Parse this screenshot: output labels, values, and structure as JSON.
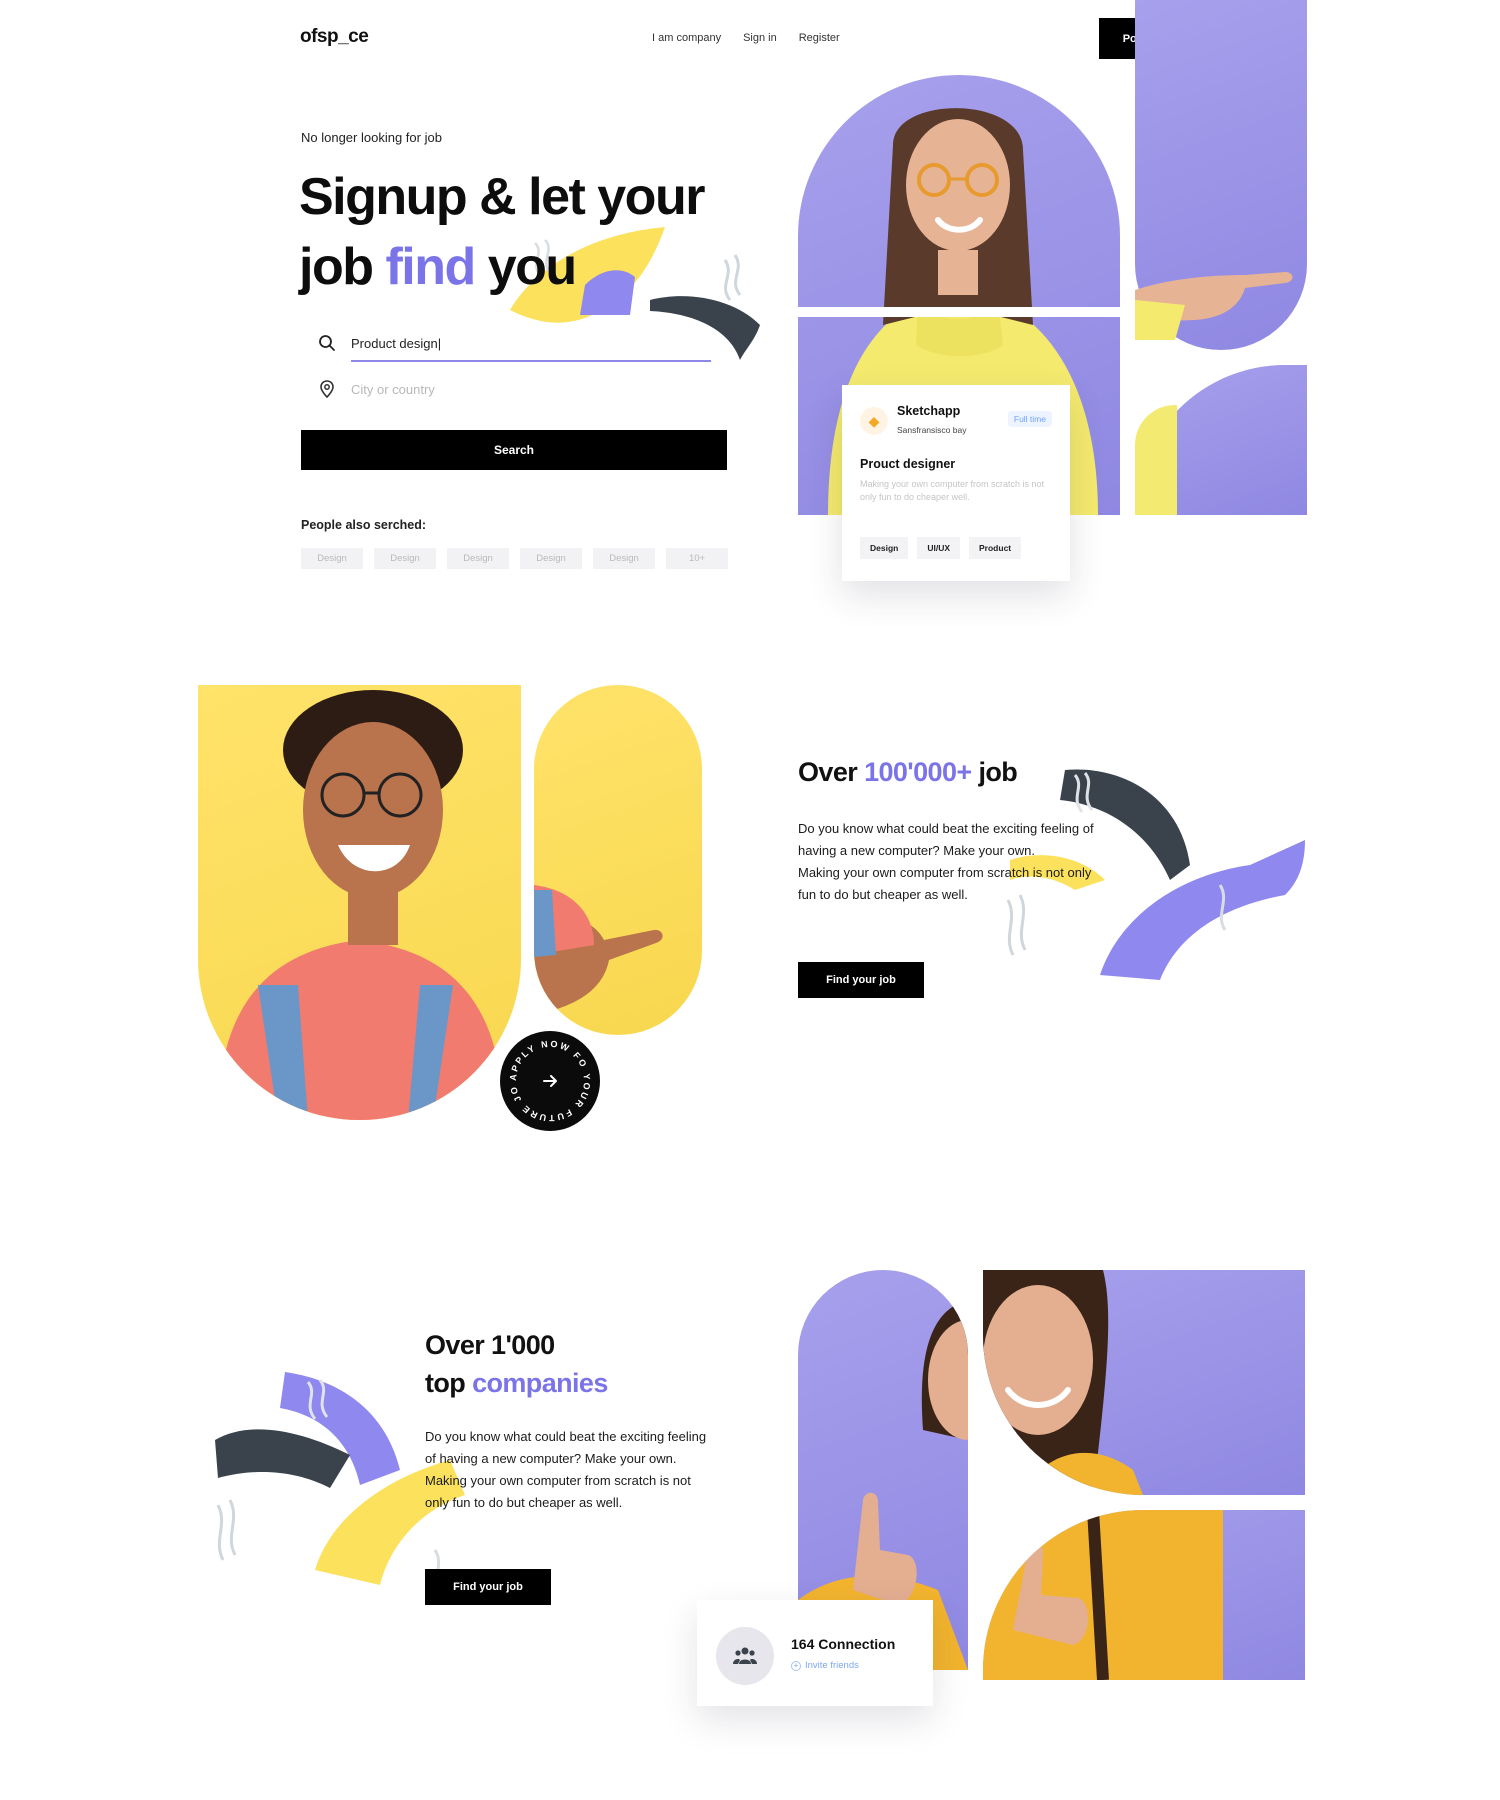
{
  "header": {
    "logo": "ofsp_ce",
    "nav": [
      "I am company",
      "Sign in",
      "Register"
    ],
    "post_job": "Post a job"
  },
  "hero": {
    "eyebrow": "No longer looking for job",
    "headline_line1": "Signup & let your",
    "headline_job": "job",
    "headline_find": "find",
    "headline_you": "you",
    "search": {
      "query_value": "Product design|",
      "location_placeholder": "City or country",
      "button": "Search"
    },
    "also_searched_label": "People also serched:",
    "chips": [
      "Design",
      "Design",
      "Design",
      "Design",
      "Design",
      "10+"
    ]
  },
  "job_card": {
    "company": "Sketchapp",
    "location": "Sansfransisco bay",
    "badge": "Full time",
    "title": "Prouct designer",
    "description": "Making your own computer from scratch is not only fun to do cheaper well.",
    "tags": [
      "Design",
      "UI/UX",
      "Product"
    ]
  },
  "section2": {
    "title_prefix": "Over",
    "title_number": "100'000+",
    "title_suffix": "job",
    "paragraph1": "Do you know what could beat the exciting feeling of having a new computer? Make your own.",
    "paragraph2": "Making your own computer from scratch is not only fun to do but cheaper as well.",
    "button": "Find your job",
    "apply_badge_text": "APPLY NOW FO YOUR FUTURE JOB",
    "apply_badge_icon": "arrow-right-icon"
  },
  "section3": {
    "title_line1": "Over 1'000",
    "title_top": "top",
    "title_companies": "companies",
    "paragraph1": "Do you know what could beat the exciting feeling of having a new computer? Make your own.",
    "paragraph2": "Making your own computer from scratch is not only fun to do but cheaper as well.",
    "button": "Find your job",
    "connection_title": "164 Connection",
    "connection_link": "Invite friends"
  },
  "colors": {
    "accent_purple": "#7b74e8",
    "shape_purple": "#9f98ea",
    "shape_yellow": "#fbdc55",
    "dark_slate": "#3a434c",
    "button_black": "#000000"
  }
}
